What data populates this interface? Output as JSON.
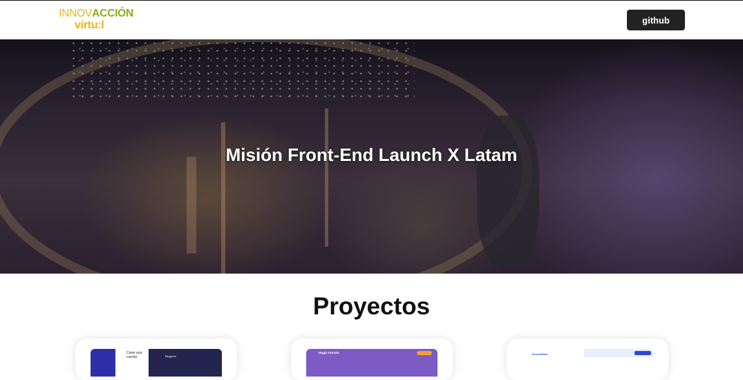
{
  "navbar": {
    "logo_line1_a": "INNOV",
    "logo_line1_b": "ACCIÓN",
    "logo_line2": "virtu:l",
    "github_label": "github"
  },
  "hero": {
    "title": "Misión Front-End Launch X Latam"
  },
  "projects": {
    "heading": "Proyectos",
    "cards": [
      {
        "thumb_text_a": "Crear una cuenta",
        "thumb_text_b": "Blogpost"
      },
      {
        "thumb_text_a": "Magic Donuts"
      },
      {
        "thumb_text_a": "Innovfollow"
      }
    ]
  },
  "colors": {
    "logo_yellow": "#e9b321",
    "logo_green": "#8cae1c",
    "button_bg": "#222222"
  }
}
